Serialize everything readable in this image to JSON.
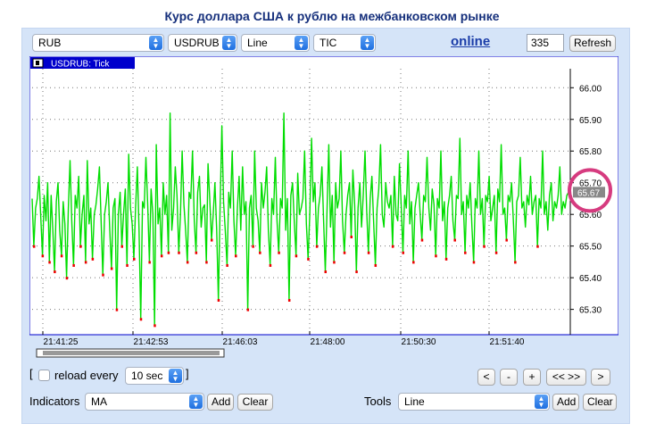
{
  "title": "Курс доллара США к рублю на межбанковском рынке",
  "toolbar": {
    "currency": "RUB",
    "pair": "USDRUB",
    "chart_type": "Line",
    "period": "TIC",
    "online_label": "online",
    "count_value": "335",
    "refresh_label": "Refresh"
  },
  "chart_data": {
    "type": "line",
    "title": "USDRUB: Tick",
    "y_ticks": [
      "66.00",
      "65.90",
      "65.80",
      "65.70",
      "65.60",
      "65.50",
      "65.40",
      "65.30"
    ],
    "x_ticks": [
      "21:41:25",
      "21:42:53",
      "21:46:03",
      "21:48:00",
      "21:50:30",
      "21:51:40"
    ],
    "ylim": [
      65.22,
      66.06
    ],
    "current_value": "65.67",
    "series": [
      {
        "line_color": "#00dd00",
        "values": [
          65.65,
          65.5,
          65.62,
          65.65,
          65.72,
          65.59,
          65.47,
          65.66,
          65.58,
          65.7,
          65.45,
          65.66,
          65.55,
          65.42,
          65.64,
          65.7,
          65.55,
          65.47,
          65.64,
          65.57,
          65.4,
          65.62,
          65.77,
          65.58,
          65.44,
          65.66,
          65.62,
          65.72,
          65.5,
          65.6,
          65.66,
          65.45,
          65.77,
          65.57,
          65.62,
          65.46,
          65.6,
          65.63,
          65.68,
          65.75,
          65.58,
          65.41,
          65.6,
          65.64,
          65.7,
          65.55,
          65.43,
          65.62,
          65.65,
          65.3,
          65.6,
          65.67,
          65.5,
          65.6,
          65.68,
          65.44,
          65.79,
          65.62,
          65.57,
          65.46,
          65.62,
          65.75,
          65.55,
          65.27,
          65.64,
          65.62,
          65.78,
          65.63,
          65.45,
          65.68,
          65.6,
          65.25,
          65.82,
          65.57,
          65.62,
          65.47,
          65.7,
          65.6,
          65.66,
          65.48,
          65.92,
          65.55,
          65.62,
          65.75,
          65.66,
          65.48,
          65.6,
          65.8,
          65.63,
          65.55,
          65.45,
          65.67,
          65.65,
          65.8,
          65.58,
          65.48,
          65.67,
          65.72,
          65.56,
          65.62,
          65.63,
          65.45,
          65.76,
          65.65,
          65.52,
          65.6,
          65.7,
          65.55,
          65.33,
          65.62,
          65.88,
          65.64,
          65.55,
          65.44,
          65.67,
          65.62,
          65.8,
          65.58,
          65.47,
          65.62,
          65.72,
          65.55,
          65.75,
          65.6,
          65.64,
          65.3,
          65.62,
          65.66,
          65.5,
          65.8,
          65.62,
          65.58,
          65.48,
          65.7,
          65.62,
          65.67,
          65.75,
          65.55,
          65.44,
          65.65,
          65.6,
          65.78,
          65.58,
          65.48,
          65.65,
          65.62,
          65.92,
          65.55,
          65.65,
          65.33,
          65.66,
          65.7,
          65.58,
          65.47,
          65.73,
          65.6,
          65.62,
          65.65,
          65.8,
          65.57,
          65.46,
          65.6,
          65.84,
          65.64,
          65.7,
          65.5,
          65.62,
          65.66,
          65.75,
          65.58,
          65.42,
          65.62,
          65.82,
          65.56,
          65.66,
          65.45,
          65.7,
          65.62,
          65.65,
          65.8,
          65.58,
          65.48,
          65.6,
          65.66,
          65.7,
          65.53,
          65.74,
          65.63,
          65.42,
          65.62,
          65.7,
          65.56,
          65.66,
          65.8,
          65.61,
          65.48,
          65.65,
          65.72,
          65.58,
          65.44,
          65.62,
          65.68,
          65.82,
          65.6,
          65.56,
          65.7,
          65.64,
          65.62,
          65.66,
          65.5,
          65.72,
          65.6,
          65.58,
          65.76,
          65.63,
          65.48,
          65.66,
          65.62,
          65.8,
          65.57,
          65.64,
          65.45,
          65.62,
          65.66,
          65.7,
          65.6,
          65.52,
          65.66,
          65.64,
          65.78,
          65.62,
          65.55,
          65.68,
          65.63,
          65.47,
          65.65,
          65.62,
          65.8,
          65.58,
          65.64,
          65.46,
          65.62,
          65.66,
          65.72,
          65.58,
          65.52,
          65.66,
          65.65,
          65.84,
          65.6,
          65.64,
          65.48,
          65.66,
          65.62,
          65.7,
          65.56,
          65.45,
          65.65,
          65.62,
          65.8,
          65.6,
          65.65,
          65.5,
          65.66,
          65.64,
          65.72,
          65.58,
          65.62,
          65.66,
          65.48,
          65.68,
          65.64,
          65.82,
          65.6,
          65.62,
          65.52,
          65.66,
          65.64,
          65.7,
          65.58,
          65.45,
          65.64,
          65.66,
          65.78,
          65.62,
          65.64,
          65.56,
          65.66,
          65.63,
          65.72,
          65.6,
          65.64,
          65.66,
          65.5,
          65.65,
          65.62,
          65.8,
          65.6,
          65.64,
          65.55,
          65.66,
          65.7,
          65.58,
          65.64,
          65.62,
          65.66,
          65.75,
          65.6,
          65.64,
          65.62,
          65.66,
          65.67
        ],
        "marker_color": "#ee0000"
      }
    ]
  },
  "controls": {
    "bracket_open": "[",
    "reload_label": "reload every",
    "reload_interval": "10 sec",
    "bracket_close": "]",
    "nav_buttons": [
      "<",
      "-",
      "+",
      "<< >>",
      ">"
    ]
  },
  "indicators": {
    "label": "Indicators",
    "value": "MA",
    "add_label": "Add",
    "clear_label": "Clear"
  },
  "tools": {
    "label": "Tools",
    "value": "Line",
    "add_label": "Add",
    "clear_label": "Clear"
  },
  "colors": {
    "panel_bg": "#d5e4f8",
    "accent": "#0000cc",
    "title": "#16307c",
    "highlight": "#d63b7f"
  }
}
